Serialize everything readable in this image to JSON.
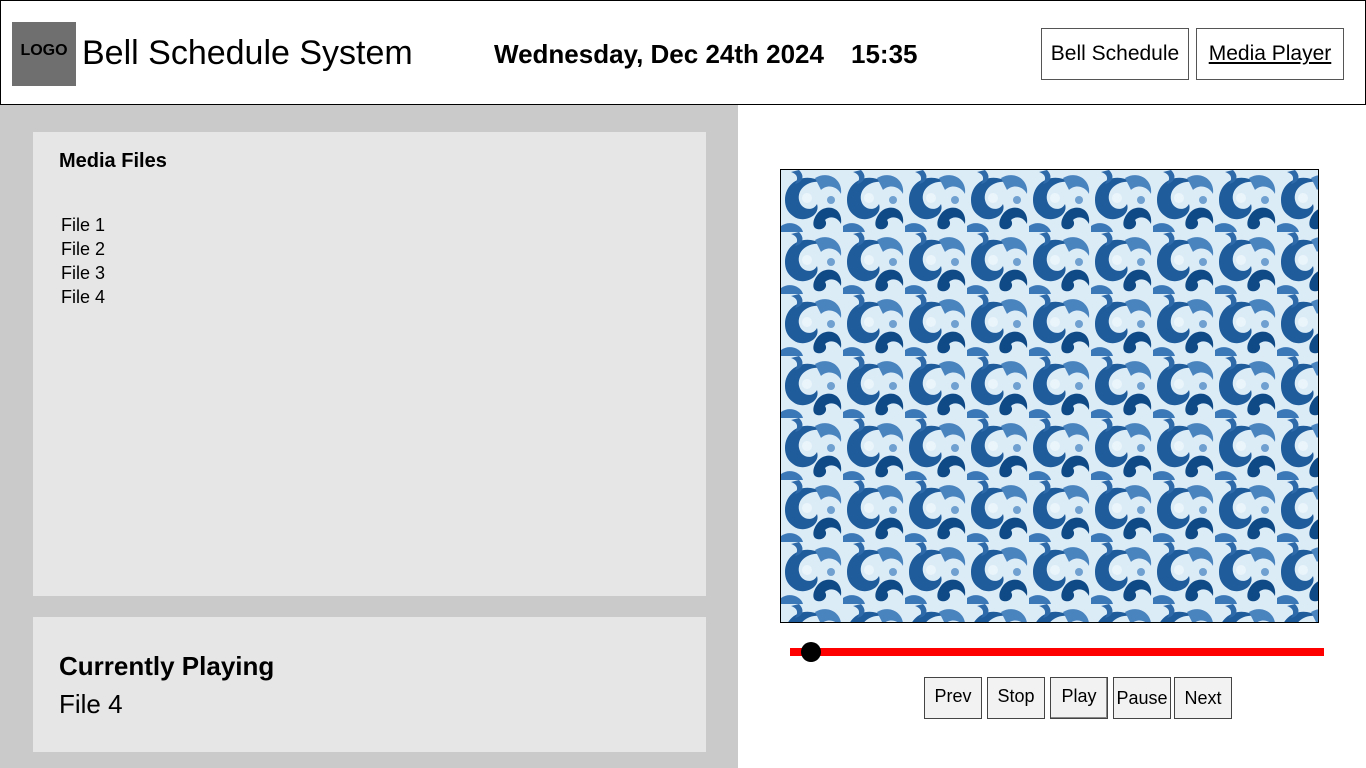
{
  "header": {
    "logo": "LOGO",
    "title": "Bell Schedule System",
    "date": "Wednesday, Dec 24th 2024",
    "time": "15:35",
    "nav": {
      "bell_schedule": "Bell Schedule",
      "media_player": "Media Player"
    }
  },
  "media_files": {
    "title": "Media Files",
    "items": [
      "File 1",
      "File 2",
      "File 3",
      "File 4"
    ]
  },
  "currently_playing": {
    "title": "Currently Playing",
    "file": "File 4"
  },
  "player": {
    "progress_fraction": 0.04,
    "controls": {
      "prev": "Prev",
      "stop": "Stop",
      "play": "Play",
      "pause": "Pause",
      "next": "Next"
    }
  },
  "colors": {
    "seek_track": "#ff0000",
    "panel": "#e6e6e6",
    "left_background": "#cacaca",
    "logo_background": "#6f6f6f"
  }
}
